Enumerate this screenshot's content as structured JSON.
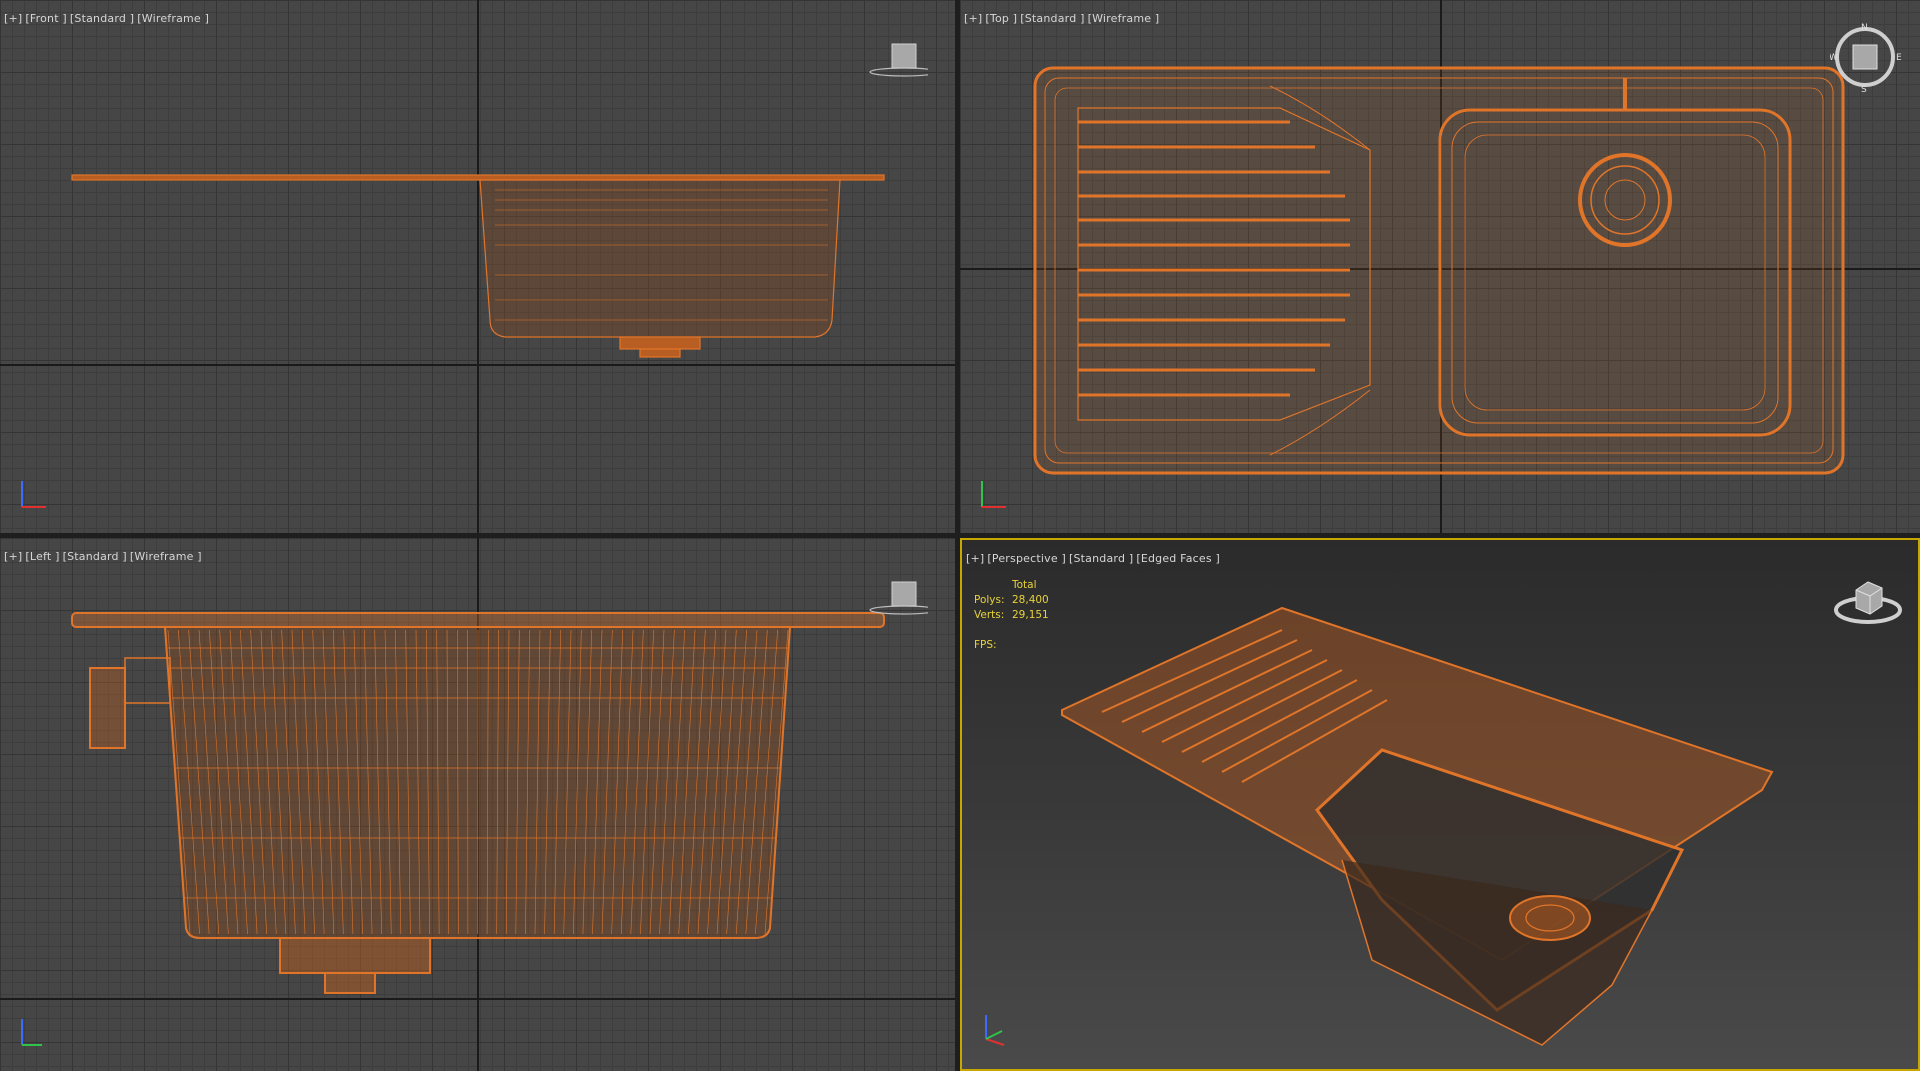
{
  "viewports": {
    "front": {
      "label_parts": [
        "[+]",
        "[Front ]",
        "[Standard ]",
        "[Wireframe ]"
      ]
    },
    "top": {
      "label_parts": [
        "[+]",
        "[Top ]",
        "[Standard ]",
        "[Wireframe ]"
      ]
    },
    "left": {
      "label_parts": [
        "[+]",
        "[Left ]",
        "[Standard ]",
        "[Wireframe ]"
      ]
    },
    "perspective": {
      "label_parts": [
        "[+]",
        "[Perspective ]",
        "[Standard ]",
        "[Edged Faces ]"
      ],
      "active": true
    }
  },
  "stats": {
    "header": "Total",
    "polys_label": "Polys:",
    "polys_value": "28,400",
    "verts_label": "Verts:",
    "verts_value": "29,151",
    "fps_label": "FPS:"
  },
  "compass": {
    "n": "N",
    "s": "S",
    "e": "E",
    "w": "W"
  },
  "colors": {
    "wireframe": "#e0752a",
    "viewport_bg": "#464646",
    "active_border": "#c7a700",
    "stats_text": "#e8d23a"
  },
  "icons": [
    "viewcube-icon",
    "axis-tripod-icon",
    "compass-ring-icon"
  ]
}
